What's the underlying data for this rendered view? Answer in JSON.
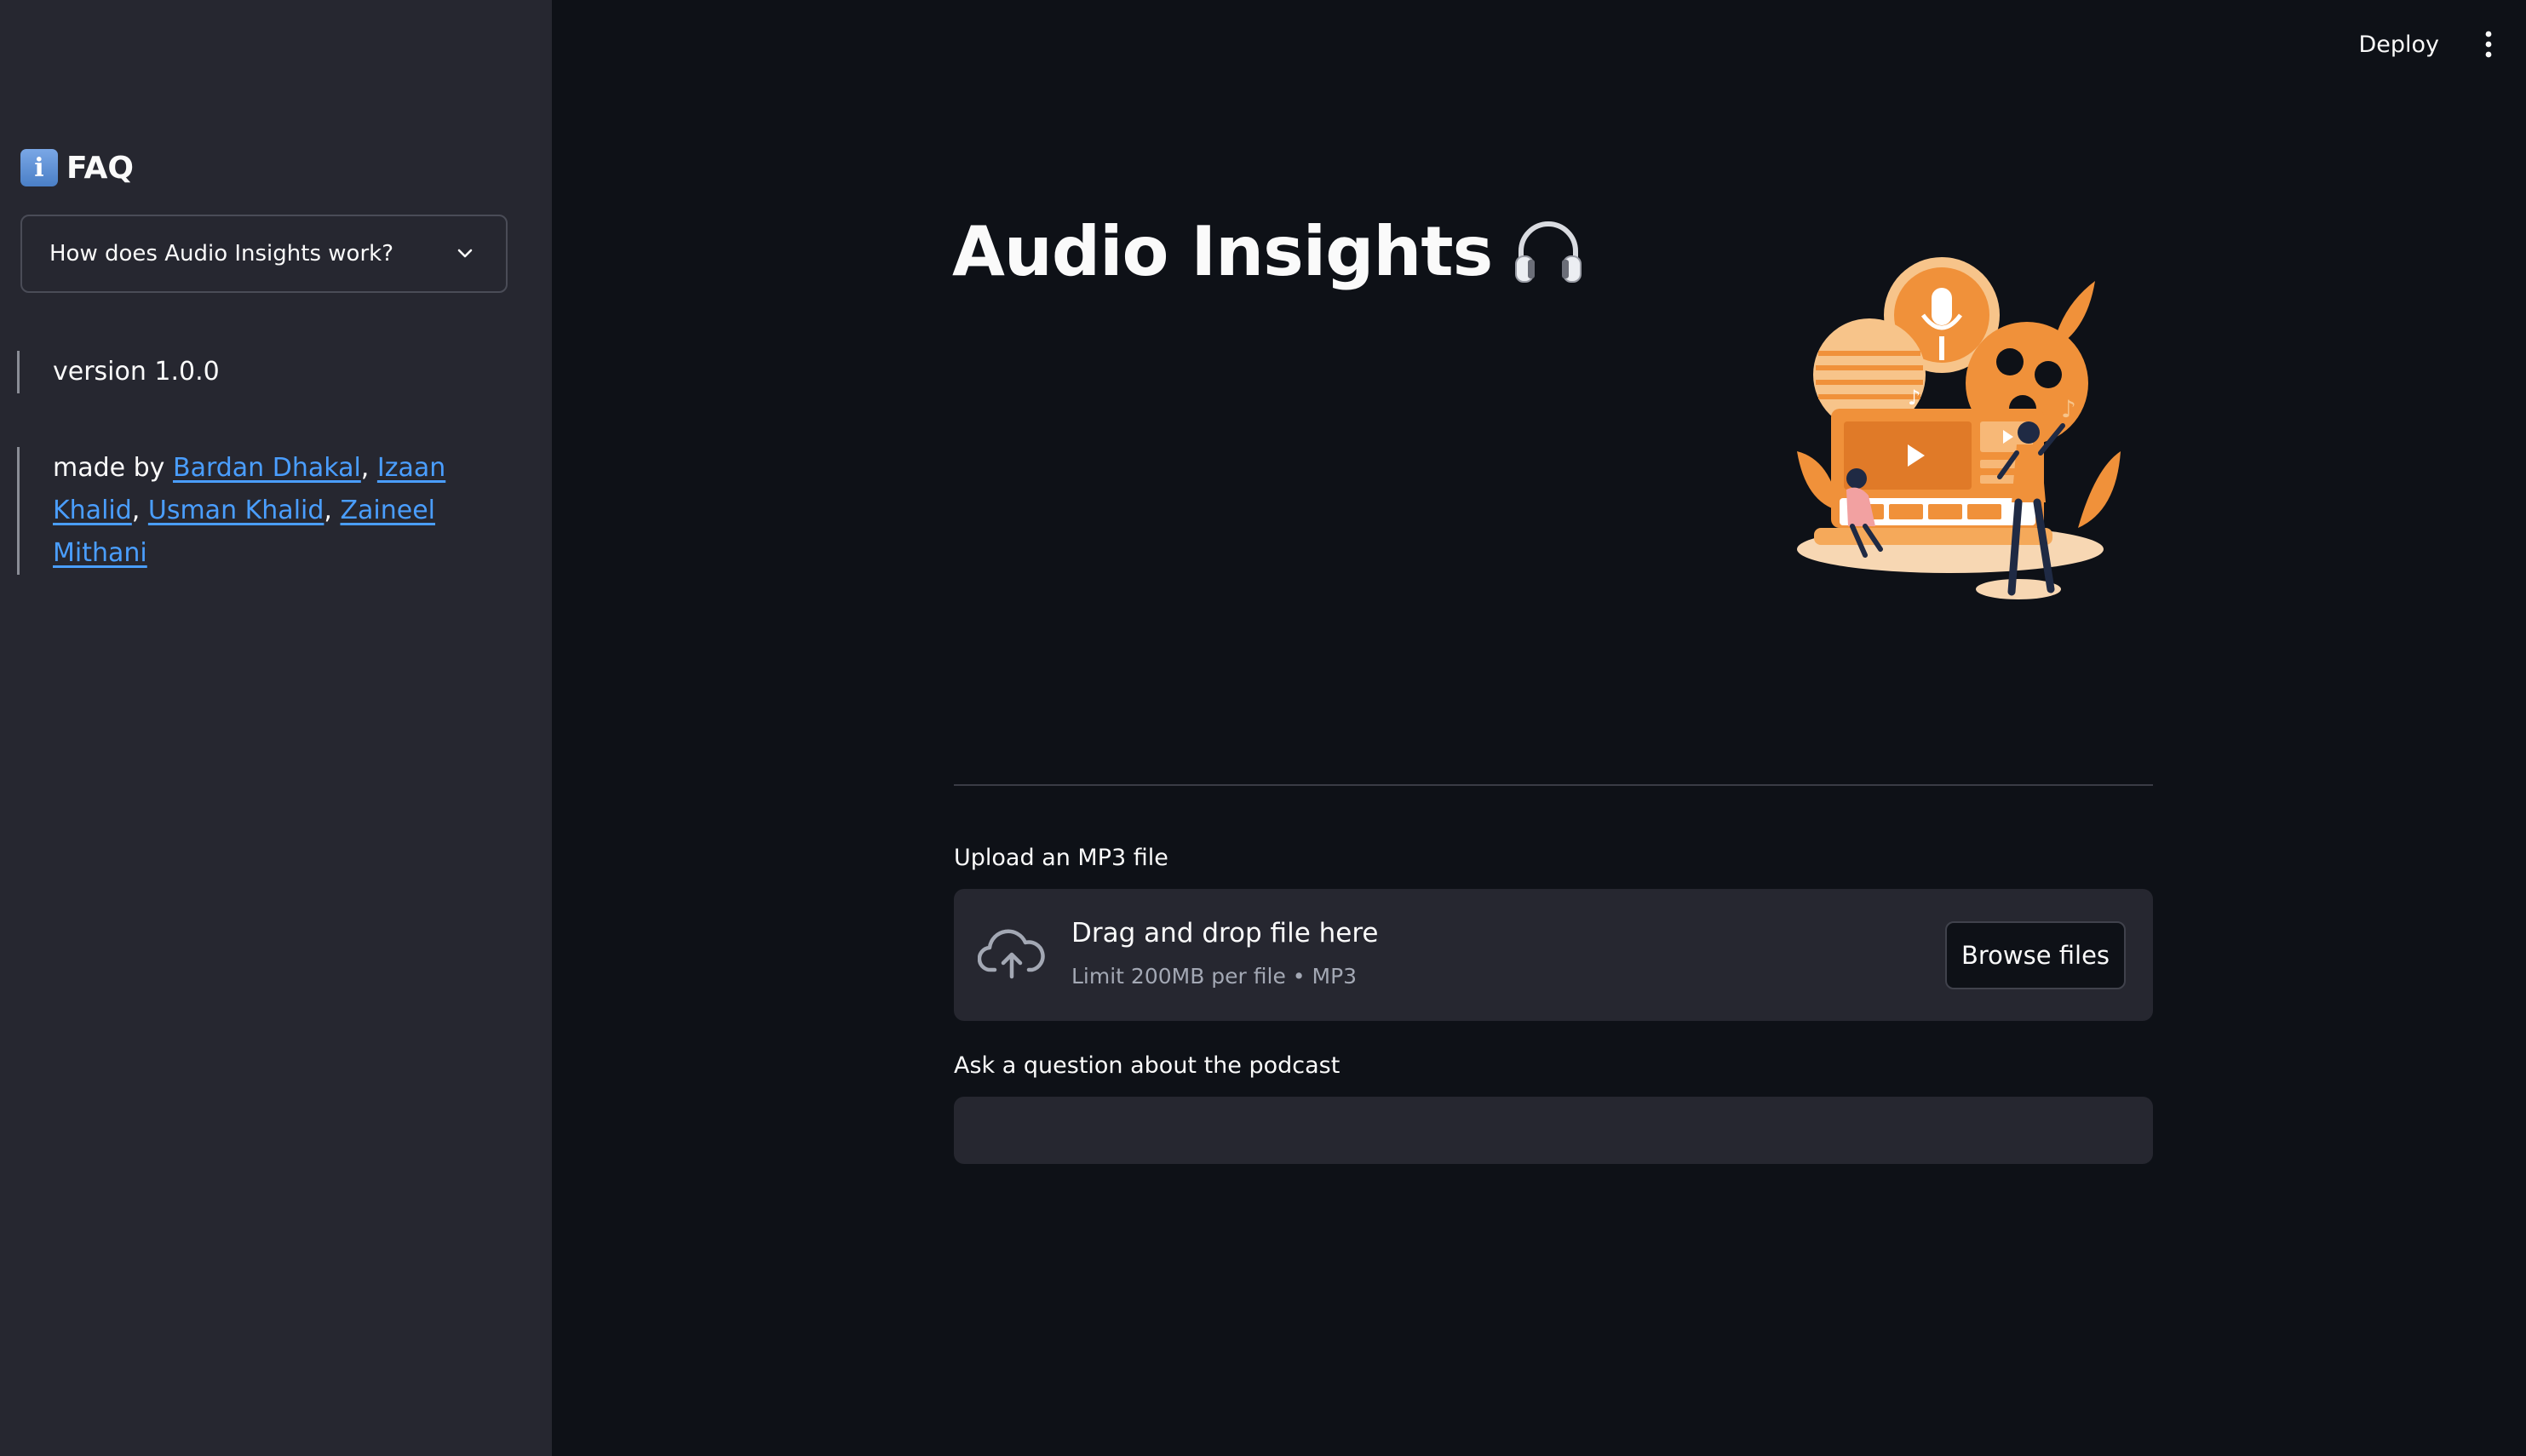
{
  "sidebar": {
    "faq_title": "FAQ",
    "faq_icon": "info-icon",
    "expander_label": "How does Audio Insights work?",
    "version_text": "version 1.0.0",
    "credits_prefix": "made by ",
    "authors": [
      "Bardan Dhakal",
      "Izaan Khalid",
      "Usman Khalid",
      "Zaineel Mithani"
    ]
  },
  "header": {
    "deploy_label": "Deploy",
    "menu_icon": "kebab-menu-icon"
  },
  "main": {
    "title": "Audio Insights",
    "title_icon": "headphones-icon",
    "uploader": {
      "label": "Upload an MP3 file",
      "drag_text": "Drag and drop file here",
      "limit_text": "Limit 200MB per file • MP3",
      "browse_label": "Browse files"
    },
    "question": {
      "label": "Ask a question about the podcast",
      "value": "",
      "placeholder": ""
    }
  },
  "colors": {
    "background": "#0e1117",
    "sidebar": "#262730",
    "link": "#4a9eff",
    "illustration_orange": "#f0913a"
  }
}
